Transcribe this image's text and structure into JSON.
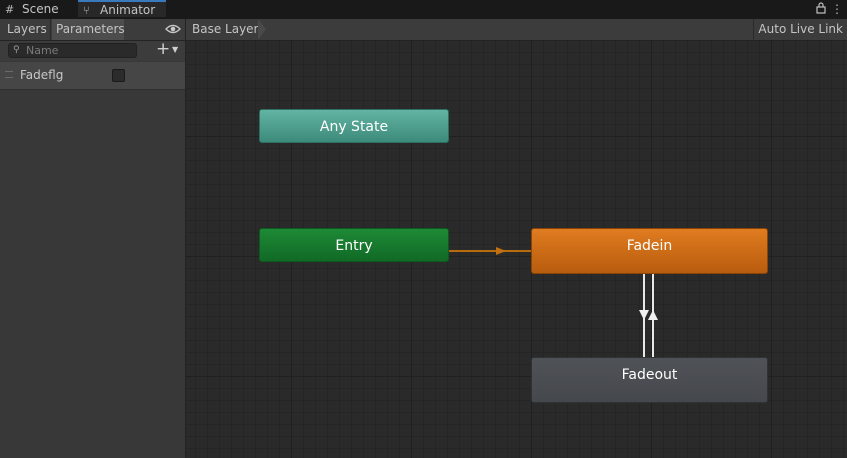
{
  "tabs": [
    {
      "label": "Scene",
      "icon": "grid-icon"
    },
    {
      "label": "Animator",
      "icon": "animator-icon"
    }
  ],
  "left_panel": {
    "tabs": {
      "layers": "Layers",
      "parameters": "Parameters"
    },
    "search": {
      "placeholder": "Name",
      "value": ""
    },
    "parameters": [
      {
        "name": "Fadeflg",
        "type": "bool",
        "checked": false
      }
    ]
  },
  "graph": {
    "breadcrumb": "Base Layer",
    "live_link_button": "Auto Live Link",
    "states": {
      "any_state": "Any State",
      "entry": "Entry",
      "fadein": "Fadein",
      "fadeout": "Fadeout"
    },
    "colors": {
      "any_state": "#52a091",
      "entry": "#177a2e",
      "default_state": "#cc6c18",
      "state": "#4a4d52",
      "transition_entry": "#c07010",
      "transition": "#e8e8e8"
    }
  }
}
